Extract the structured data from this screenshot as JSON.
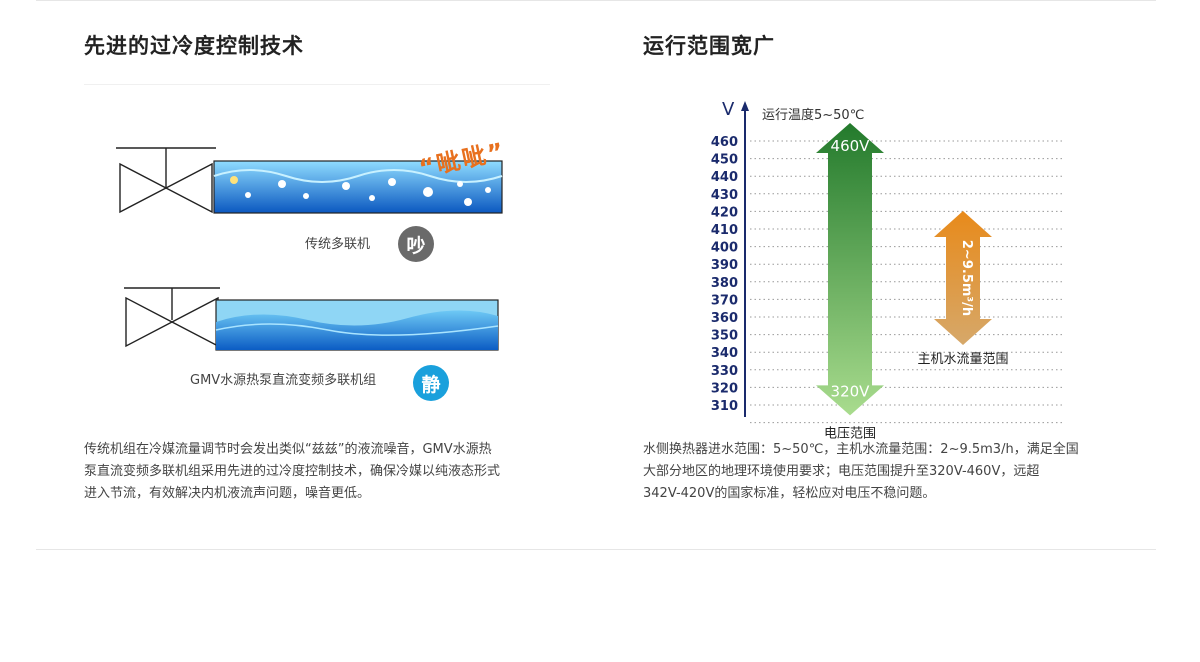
{
  "left": {
    "title": "先进的过冷度控制技术",
    "noise_text": "“呲呲”",
    "traditional_label": "传统多联机",
    "traditional_badge": "吵",
    "gmv_label": "GMV水源热泵直流变频多联机组",
    "gmv_badge": "静",
    "description": [
      "传统机组在冷媒流量调节时会发出类似“兹兹”的液流噪音，GMV水源热",
      "泵直流变频多联机组采用先进的过冷度控制技术，确保冷媒以纯液态形式",
      "进入节流，有效解决内机液流声问题，噪音更低。"
    ]
  },
  "right": {
    "title": "运行范围宽广",
    "chart_data": {
      "type": "range",
      "y_unit": "V",
      "y_ticks": [
        460,
        450,
        440,
        430,
        420,
        410,
        400,
        390,
        380,
        370,
        360,
        350,
        340,
        330,
        320,
        310
      ],
      "annotation": "运行温度5~50℃",
      "voltage_range": {
        "label": "电压范围",
        "top": "460V",
        "bottom": "320V",
        "from": 320,
        "to": 460,
        "color": "#2e8b3e"
      },
      "water_flow_range": {
        "label": "主机水流量范围",
        "text": "2~9.5m³/h",
        "color": "#e0891e"
      }
    },
    "description": [
      "水侧换热器进水范围：5~50℃，主机水流量范围：2~9.5m3/h，满足全国",
      "大部分地区的地理环境使用要求；电压范围提升至320V-460V，远超",
      "342V-420V的国家标准，轻松应对电压不稳问题。"
    ]
  },
  "colors": {
    "water_dark": "#1466c8",
    "water_light": "#5cc0f0",
    "noise_orange": "#e8701e",
    "badge_gray": "#6a6a6a",
    "badge_blue": "#1aa0dc"
  }
}
